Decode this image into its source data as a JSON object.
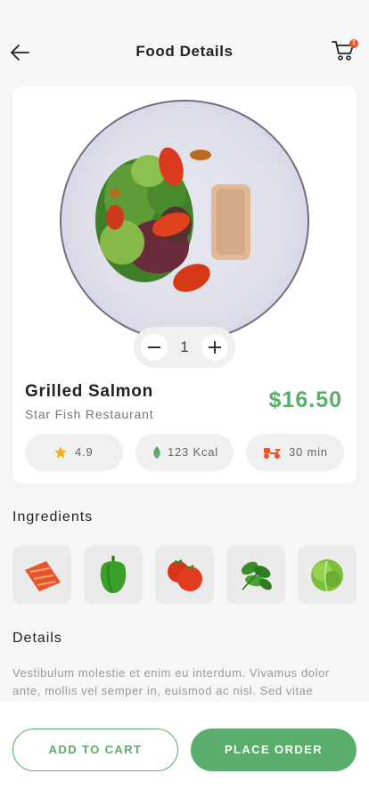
{
  "header": {
    "title": "Food Details",
    "cart_badge": "1"
  },
  "product": {
    "name": "Grilled Salmon",
    "restaurant": "Star Fish Restaurant",
    "price": "$16.50",
    "quantity": "1"
  },
  "stats": {
    "rating": "4.9",
    "calories": "123 Kcal",
    "delivery": "30 min"
  },
  "ingredients": {
    "title": "Ingredients",
    "items": [
      "salmon",
      "green-pepper",
      "tomato",
      "basil",
      "lettuce"
    ]
  },
  "details": {
    "title": "Details",
    "text": "Vestibulum molestie et enim eu interdum. Vivamus dolor ante, mollis vel semper in, euismod ac nisl. Sed vitae"
  },
  "actions": {
    "add_to_cart": "ADD TO CART",
    "place_order": "PLACE ORDER"
  },
  "colors": {
    "accent": "#5aad6a",
    "badge": "#e8552b",
    "star": "#f2b01e"
  }
}
